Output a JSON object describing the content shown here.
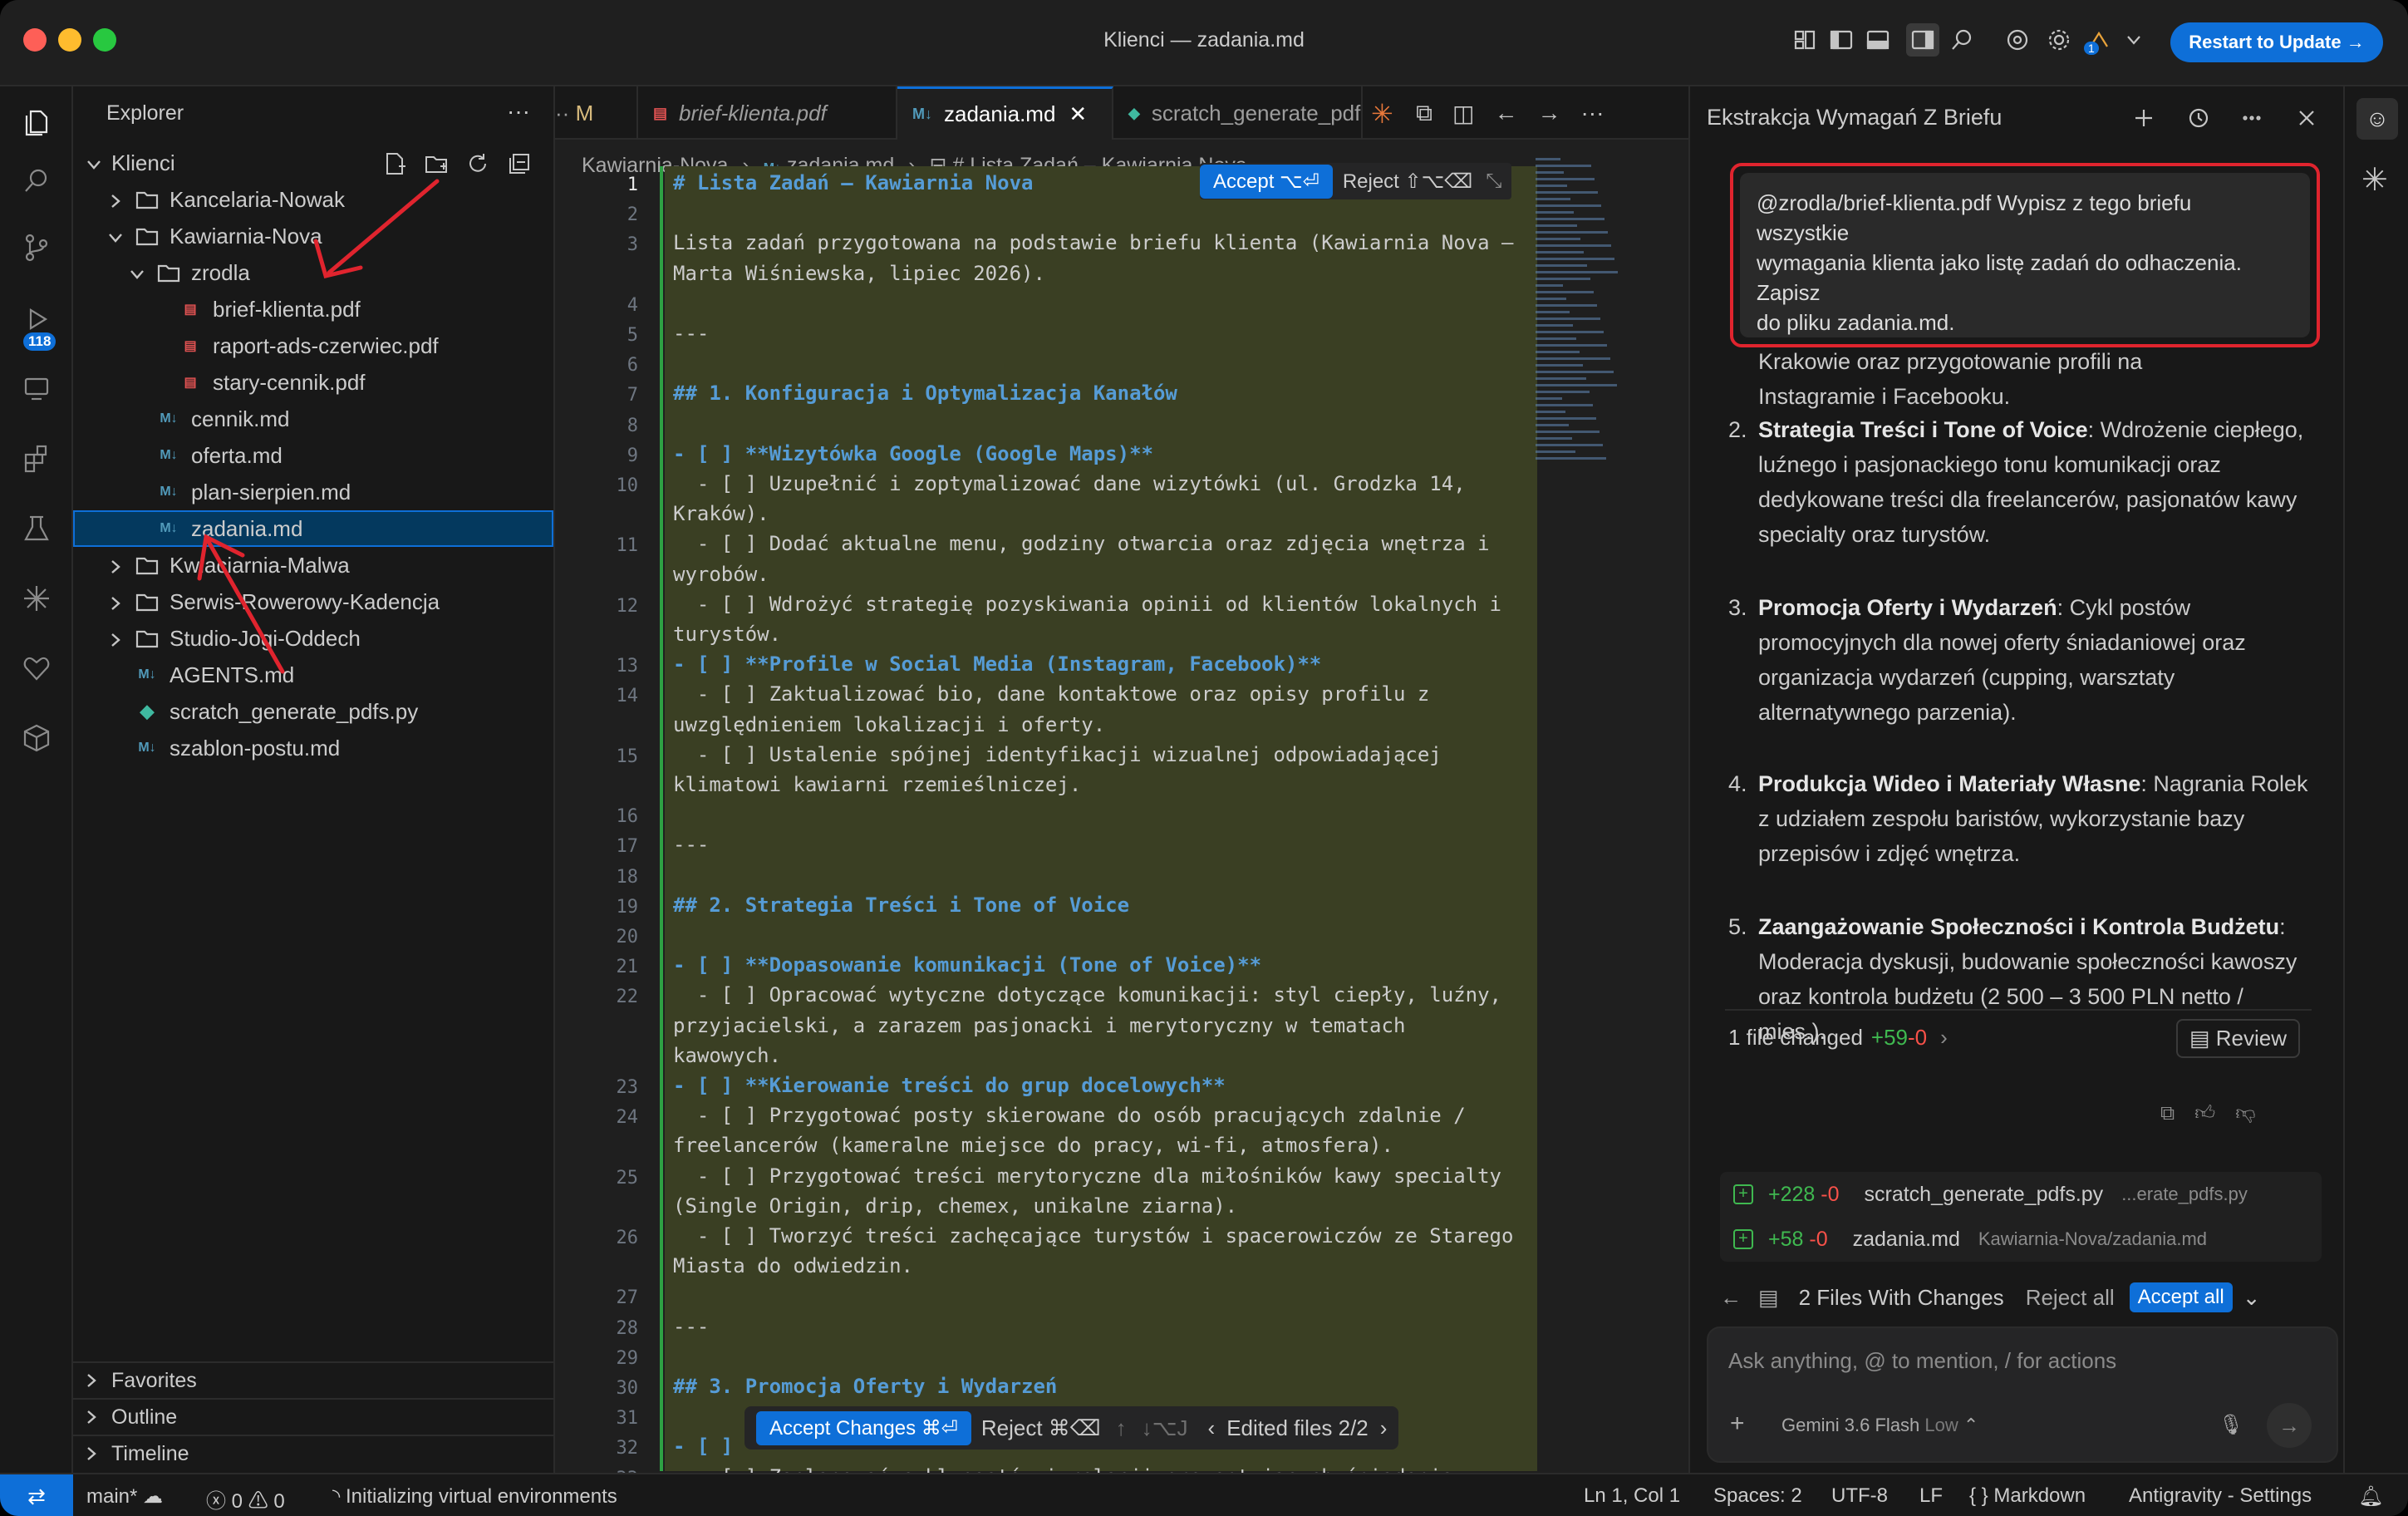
{
  "window": {
    "title": "Klienci — zadania.md",
    "restart_label": "Restart to Update →"
  },
  "sidebar": {
    "title": "Explorer",
    "root": "Klienci",
    "items": [
      {
        "label": "Kancelaria-Nowak",
        "type": "folder",
        "depth": 1,
        "open": false
      },
      {
        "label": "Kawiarnia-Nova",
        "type": "folder",
        "depth": 1,
        "open": true
      },
      {
        "label": "zrodla",
        "type": "folder",
        "depth": 2,
        "open": true
      },
      {
        "label": "brief-klienta.pdf",
        "type": "pdf",
        "depth": 3
      },
      {
        "label": "raport-ads-czerwiec.pdf",
        "type": "pdf",
        "depth": 3
      },
      {
        "label": "stary-cennik.pdf",
        "type": "pdf",
        "depth": 3
      },
      {
        "label": "cennik.md",
        "type": "md",
        "depth": 2
      },
      {
        "label": "oferta.md",
        "type": "md",
        "depth": 2
      },
      {
        "label": "plan-sierpien.md",
        "type": "md",
        "depth": 2
      },
      {
        "label": "zadania.md",
        "type": "md",
        "depth": 2,
        "selected": true
      },
      {
        "label": "Kwiaciarnia-Malwa",
        "type": "folder",
        "depth": 1,
        "open": false
      },
      {
        "label": "Serwis-Rowerowy-Kadencja",
        "type": "folder",
        "depth": 1,
        "open": false
      },
      {
        "label": "Studio-Jogi-Oddech",
        "type": "folder",
        "depth": 1,
        "open": false
      },
      {
        "label": "AGENTS.md",
        "type": "md",
        "depth": 1
      },
      {
        "label": "scratch_generate_pdfs.py",
        "type": "py",
        "depth": 1
      },
      {
        "label": "szablon-postu.md",
        "type": "md",
        "depth": 1
      }
    ],
    "sections": [
      "Favorites",
      "Outline",
      "Timeline"
    ],
    "scm_badge": "118"
  },
  "editor": {
    "tabs": [
      {
        "label": "M",
        "italic": false
      },
      {
        "label": "brief-klienta.pdf",
        "italic": true
      },
      {
        "label": "zadania.md",
        "active": true
      },
      {
        "label": "scratch_generate_pdfs"
      }
    ],
    "breadcrumb": [
      "Kawiarnia-Nova",
      "zadania.md",
      "# Lista Zadań – Kawiarnia Nova"
    ],
    "accept": "Accept ⌥⏎",
    "reject": "Reject ⇧⌥⌫",
    "lines": [
      {
        "n": "1",
        "t": "# Lista Zadań – Kawiarnia Nova",
        "c": "h"
      },
      {
        "n": "2",
        "t": ""
      },
      {
        "n": "3",
        "t": "Lista zadań przygotowana na podstawie briefu klienta (Kawiarnia Nova –"
      },
      {
        "n": "",
        "t": "Marta Wiśniewska, lipiec 2026)."
      },
      {
        "n": "4",
        "t": ""
      },
      {
        "n": "5",
        "t": "---"
      },
      {
        "n": "6",
        "t": ""
      },
      {
        "n": "7",
        "t": "## 1. Konfiguracja i Optymalizacja Kanałów",
        "c": "h"
      },
      {
        "n": "8",
        "t": ""
      },
      {
        "n": "9",
        "t": "- [ ] **Wizytówka Google (Google Maps)**",
        "c": "b"
      },
      {
        "n": "10",
        "t": "  - [ ] Uzupełnić i zoptymalizować dane wizytówki (ul. Grodzka 14,"
      },
      {
        "n": "",
        "t": "Kraków)."
      },
      {
        "n": "11",
        "t": "  - [ ] Dodać aktualne menu, godziny otwarcia oraz zdjęcia wnętrza i"
      },
      {
        "n": "",
        "t": "wyrobów."
      },
      {
        "n": "12",
        "t": "  - [ ] Wdrożyć strategię pozyskiwania opinii od klientów lokalnych i"
      },
      {
        "n": "",
        "t": "turystów."
      },
      {
        "n": "13",
        "t": "- [ ] **Profile w Social Media (Instagram, Facebook)**",
        "c": "b"
      },
      {
        "n": "14",
        "t": "  - [ ] Zaktualizować bio, dane kontaktowe oraz opisy profilu z"
      },
      {
        "n": "",
        "t": "uwzględnieniem lokalizacji i oferty."
      },
      {
        "n": "15",
        "t": "  - [ ] Ustalenie spójnej identyfikacji wizualnej odpowiadającej"
      },
      {
        "n": "",
        "t": "klimatowi kawiarni rzemieślniczej."
      },
      {
        "n": "16",
        "t": ""
      },
      {
        "n": "17",
        "t": "---"
      },
      {
        "n": "18",
        "t": ""
      },
      {
        "n": "19",
        "t": "## 2. Strategia Treści i Tone of Voice",
        "c": "h"
      },
      {
        "n": "20",
        "t": ""
      },
      {
        "n": "21",
        "t": "- [ ] **Dopasowanie komunikacji (Tone of Voice)**",
        "c": "b"
      },
      {
        "n": "22",
        "t": "  - [ ] Opracować wytyczne dotyczące komunikacji: styl ciepły, luźny,"
      },
      {
        "n": "",
        "t": "przyjacielski, a zarazem pasjonacki i merytoryczny w tematach"
      },
      {
        "n": "",
        "t": "kawowych."
      },
      {
        "n": "23",
        "t": "- [ ] **Kierowanie treści do grup docelowych**",
        "c": "b"
      },
      {
        "n": "24",
        "t": "  - [ ] Przygotować posty skierowane do osób pracujących zdalnie /"
      },
      {
        "n": "",
        "t": "freelancerów (kameralne miejsce do pracy, wi-fi, atmosfera)."
      },
      {
        "n": "25",
        "t": "  - [ ] Przygotować treści merytoryczne dla miłośników kawy specialty"
      },
      {
        "n": "",
        "t": "(Single Origin, drip, chemex, unikalne ziarna)."
      },
      {
        "n": "26",
        "t": "  - [ ] Tworzyć treści zachęcające turystów i spacerowiczów ze Starego"
      },
      {
        "n": "",
        "t": "Miasta do odwiedzin."
      },
      {
        "n": "27",
        "t": ""
      },
      {
        "n": "28",
        "t": "---"
      },
      {
        "n": "29",
        "t": ""
      },
      {
        "n": "30",
        "t": "## 3. Promocja Oferty i Wydarzeń",
        "c": "h"
      },
      {
        "n": "31",
        "t": ""
      },
      {
        "n": "32",
        "t": "- [ ] *",
        "c": "b"
      },
      {
        "n": "33",
        "t": "  - [ ] Zaplanować cykl postów i relacji prezentujących śniadania z"
      }
    ],
    "bottom": {
      "accept_changes": "Accept Changes ⌘⏎",
      "reject": "Reject ⌘⌫",
      "edited": "Edited files 2/2"
    }
  },
  "chat": {
    "title": "Ekstrakcja Wymagań Z Briefu",
    "prompt_lines": [
      "@zrodla/brief-klienta.pdf Wypisz z tego briefu",
      "wszystkie",
      "wymagania klienta jako listę zadań do odhaczenia.",
      "Zapisz",
      "do pliku zadania.md."
    ],
    "response_intro": [
      "Krakowie oraz przygotowanie profili na",
      "Instagramie i Facebooku."
    ],
    "response_items": [
      {
        "num": "2.",
        "bold": "Strategia Treści i Tone of Voice",
        "text": ": Wdrożenie ciepłego, luźnego i pasjonackiego tonu komunikacji oraz dedykowane treści dla freelancerów, pasjonatów kawy specialty oraz turystów."
      },
      {
        "num": "3.",
        "bold": "Promocja Oferty i Wydarzeń",
        "text": ": Cykl postów promocyjnych dla nowej oferty śniadaniowej oraz organizacja wydarzeń (cupping, warsztaty alternatywnego parzenia)."
      },
      {
        "num": "4.",
        "bold": "Produkcja Wideo i Materiały Własne",
        "text": ": Nagrania Rolek z udziałem zespołu baristów, wykorzystanie bazy przepisów i zdjęć wnętrza."
      },
      {
        "num": "5.",
        "bold": "Zaangażowanie Społeczności i Kontrola Budżetu",
        "text": ": Moderacja dyskusji, budowanie społeczności kawoszy oraz kontrola budżetu (2 500 – 3 500 PLN netto / mies.)."
      }
    ],
    "files_changed": "1 file changed",
    "plus": "+59",
    "minus": "-0",
    "review": "Review",
    "files": [
      {
        "plus": "+228",
        "minus": "-0",
        "name": "scratch_generate_pdfs.py",
        "path": "...erate_pdfs.py"
      },
      {
        "plus": "+58",
        "minus": "-0",
        "name": "zadania.md",
        "path": "Kawiarnia-Nova/zadania.md"
      }
    ],
    "with_changes": "2 Files With Changes",
    "reject_all": "Reject all",
    "accept_all": "Accept all",
    "placeholder": "Ask anything, @ to mention, / for actions",
    "model": "Gemini 3.6 Flash",
    "model_mode": "Low"
  },
  "status": {
    "branch": "main*",
    "errors": "0",
    "warnings": "0",
    "task": "Initializing virtual environments",
    "position": "Ln 1, Col 1",
    "spaces": "Spaces: 2",
    "encoding": "UTF-8",
    "eol": "LF",
    "language": "Markdown",
    "settings": "Antigravity - Settings"
  },
  "colors": {
    "accent": "#0e6fd8",
    "annotation": "#e0242e",
    "diff_bg": "#3a3f23"
  }
}
